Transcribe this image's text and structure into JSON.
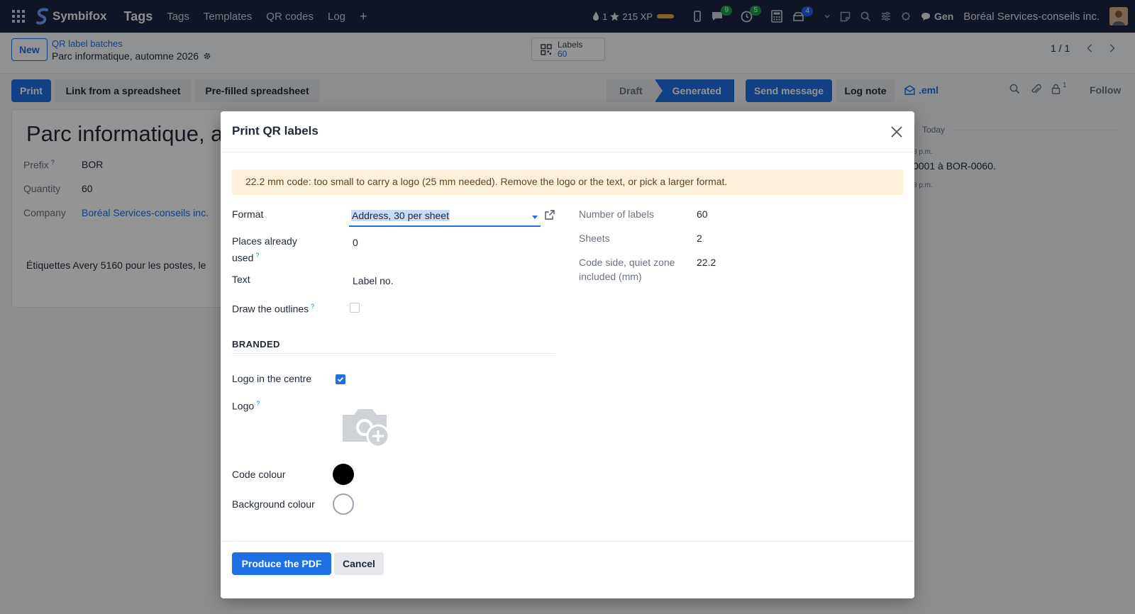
{
  "navbar": {
    "brand": "Symbifox",
    "app_name": "Tags",
    "menu": [
      "Tags",
      "Templates",
      "QR codes",
      "Log"
    ],
    "add_symbol": "+",
    "streak": "1",
    "xp": "215 XP",
    "chat_count": "9",
    "activity_count": "5",
    "notification_count": "4",
    "assistant_label": "Gen",
    "company": "Boréal Services-conseils inc."
  },
  "control_panel": {
    "new_label": "New",
    "breadcrumb_parent": "QR label batches",
    "breadcrumb_current": "Parc informatique, automne 2026",
    "smart_button": {
      "label": "Labels",
      "count": "60"
    },
    "pager": "1 / 1"
  },
  "actions": {
    "print": "Print",
    "link_spreadsheet": "Link from a spreadsheet",
    "prefilled_spreadsheet": "Pre-filled spreadsheet",
    "statuses": [
      "Draft",
      "Generated"
    ],
    "active_status": "Generated",
    "send_message": "Send message",
    "log_note": "Log note",
    "eml": ".eml",
    "follower_count": "1",
    "follow": "Follow"
  },
  "record": {
    "title": "Parc informatique, automne 2026",
    "prefix_label": "Prefix",
    "prefix_value": "BOR",
    "quantity_label": "Quantity",
    "quantity_value": "60",
    "company_label": "Company",
    "company_value": "Boréal Services-conseils inc.",
    "description": "Étiquettes Avery 5160 pour les postes, le"
  },
  "chatter": {
    "date_separator": "Today",
    "time_1": "8 p.m.",
    "message": "0001 à BOR-0060.",
    "time_2": "8 p.m."
  },
  "dialog": {
    "title": "Print QR labels",
    "warning": "22.2 mm code: too small to carry a logo (25 mm needed). Remove the logo or the text, or pick a larger format.",
    "format_label": "Format",
    "format_value": "Address, 30 per sheet",
    "places_used_label": "Places already used",
    "places_used_value": "0",
    "text_label": "Text",
    "text_value": "Label no.",
    "outlines_label": "Draw the outlines",
    "outlines_checked": false,
    "help_mark": "?",
    "number_of_labels_label": "Number of labels",
    "number_of_labels_value": "60",
    "sheets_label": "Sheets",
    "sheets_value": "2",
    "code_side_label": "Code side, quiet zone included (mm)",
    "code_side_value": "22.2",
    "section_branded": "BRANDED",
    "logo_centre_label": "Logo in the centre",
    "logo_centre_checked": true,
    "logo_label": "Logo",
    "code_colour_label": "Code colour",
    "code_colour": "#000000",
    "background_colour_label": "Background colour",
    "background_colour": "#ffffff",
    "primary_button": "Produce the PDF",
    "cancel_button": "Cancel"
  },
  "colors": {
    "navbar_bg": "#1b2540",
    "primary": "#1f6fe5",
    "warning_bg": "#fdf1dc"
  }
}
